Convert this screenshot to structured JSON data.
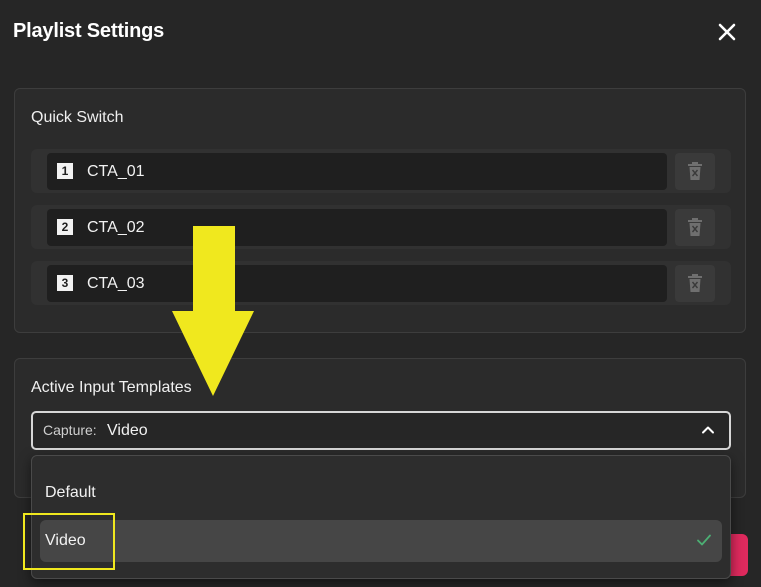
{
  "dialog": {
    "title": "Playlist Settings"
  },
  "quick_switch": {
    "title": "Quick Switch",
    "items": [
      {
        "number": "1",
        "name": "CTA_01"
      },
      {
        "number": "2",
        "name": "CTA_02"
      },
      {
        "number": "3",
        "name": "CTA_03"
      }
    ]
  },
  "active_input_templates": {
    "title": "Active Input Templates",
    "select": {
      "prefix": "Capture:",
      "value": "Video"
    },
    "options": [
      {
        "label": "Default",
        "selected": false
      },
      {
        "label": "Video",
        "selected": true
      }
    ]
  },
  "icons": {
    "close": "close-icon",
    "delete": "trash-icon",
    "chevron": "chevron-up-icon",
    "check": "check-icon"
  },
  "colors": {
    "background": "#262626",
    "panel": "#2b2b2b",
    "accent_red": "#e02a5e",
    "check_green": "#4caf74",
    "annotation_yellow": "#f0e81e"
  }
}
